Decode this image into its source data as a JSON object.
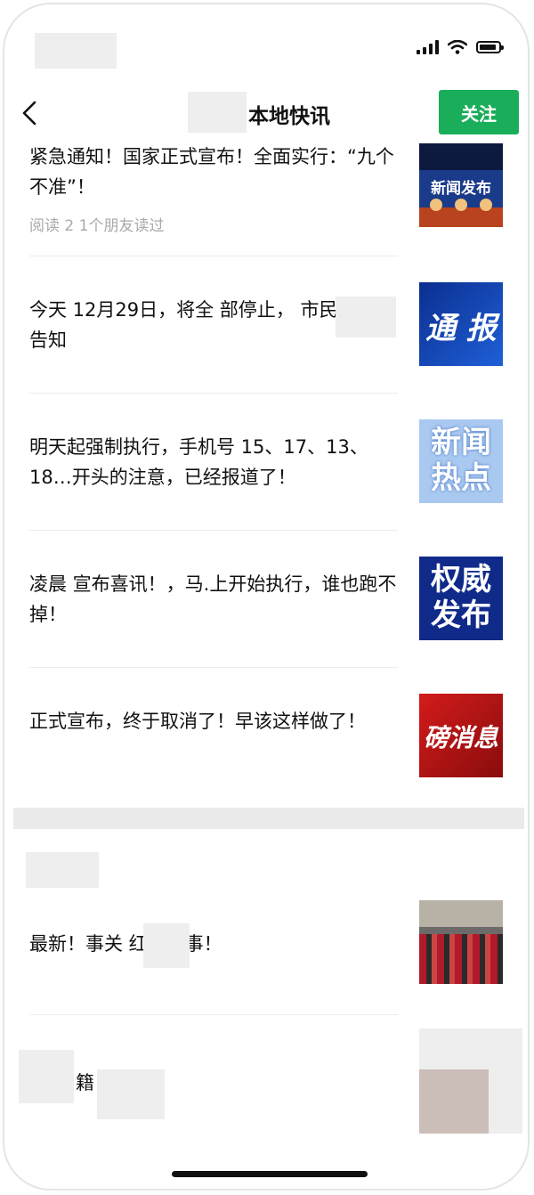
{
  "nav": {
    "title": "本地快讯",
    "follow_label": "关注"
  },
  "articles": [
    {
      "title": "紧急通知！国家正式宣布！全面实行：“九个不准”！",
      "meta": "阅读 2   1个朋友读过",
      "thumb_icon": "news-conference-thumbnail",
      "thumb_text": "新闻发布"
    },
    {
      "title": "今天 12月29日，将全 部停止，     市民相 互告知",
      "meta": "",
      "thumb_icon": "bulletin-thumbnail",
      "thumb_text": "通  报"
    },
    {
      "title": "明天起强制执行，手机号 15、17、13、18…开头的注意，已经报道了！",
      "meta": "",
      "thumb_icon": "hot-news-thumbnail",
      "thumb_text": "新闻热点"
    },
    {
      "title": "凌晨 宣布喜讯！，马.上开始执行，谁也跑不掉！",
      "meta": "",
      "thumb_icon": "authoritative-release-thumbnail",
      "thumb_text": "权威发布"
    },
    {
      "title": "正式宣布，终于取消了！早该这样做了！",
      "meta": "",
      "thumb_icon": "breaking-news-thumbnail",
      "thumb_text": "磅消息"
    }
  ],
  "section2_articles": [
    {
      "title": "最新！事关      红白喜事！",
      "thumb_icon": "crowd-photo-thumbnail"
    },
    {
      "title": "籍       ，被查！",
      "thumb_icon": "blurred-thumbnail"
    }
  ],
  "colors": {
    "accent": "#1aad5a",
    "meta_text": "#aaaaaa"
  }
}
